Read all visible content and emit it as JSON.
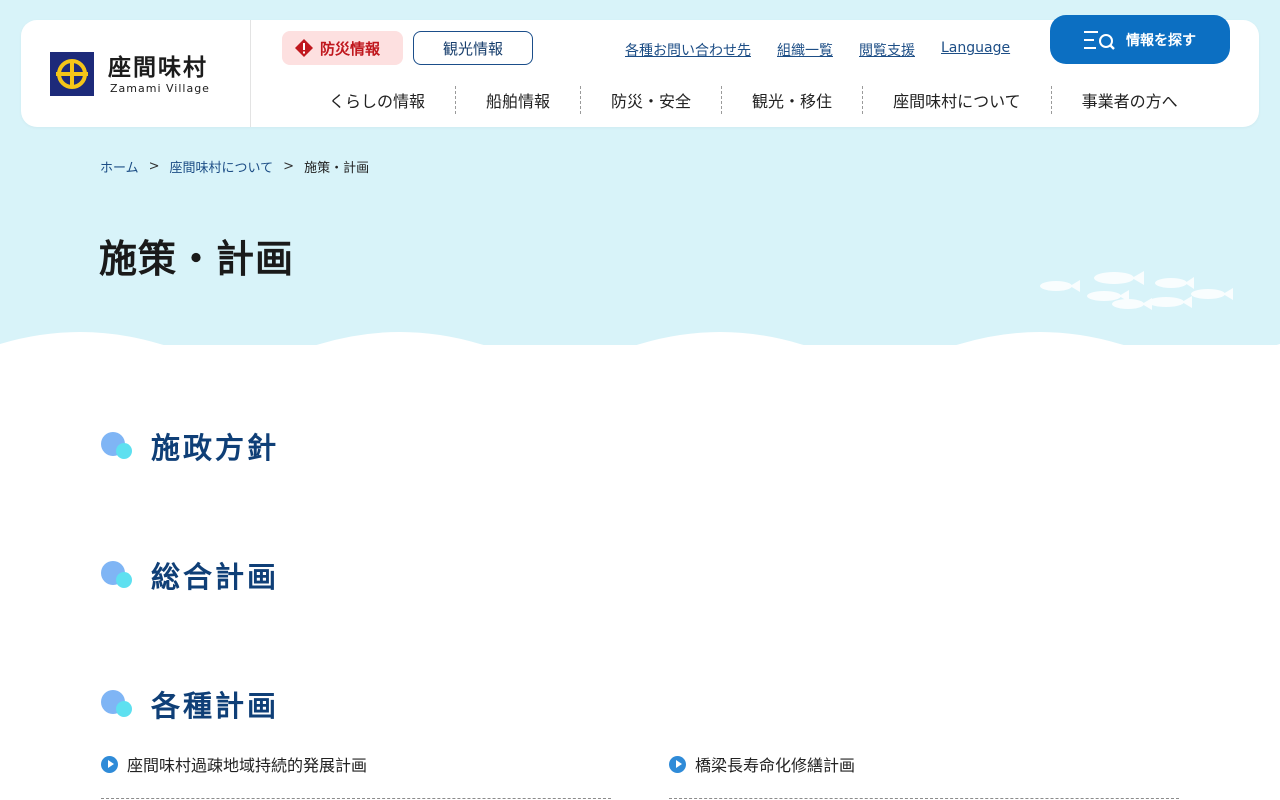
{
  "header": {
    "logo_jp": "座間味村",
    "logo_en": "Zamami Village",
    "disaster_button": "防災情報",
    "tourism_button": "観光情報",
    "utility_links": [
      "各種お問い合わせ先",
      "組織一覧",
      "閲覧支援",
      "Language"
    ],
    "search_button": "情報を探す",
    "nav": [
      "くらしの情報",
      "船舶情報",
      "防災・安全",
      "観光・移住",
      "座間味村について",
      "事業者の方へ"
    ]
  },
  "breadcrumb": {
    "items": [
      "ホーム",
      "座間味村について"
    ],
    "separator": ">",
    "current": "施策・計画"
  },
  "page_title": "施策・計画",
  "sections": [
    {
      "heading": "施政方針"
    },
    {
      "heading": "総合計画"
    },
    {
      "heading": "各種計画",
      "links": [
        "座間味村過疎地域持続的発展計画",
        "橋梁長寿命化修繕計画"
      ]
    }
  ],
  "colors": {
    "hero_bg": "#d8f3f9",
    "accent_blue": "#0c6fc2",
    "heading_navy": "#0f3f77",
    "disaster_red": "#c0181e"
  }
}
